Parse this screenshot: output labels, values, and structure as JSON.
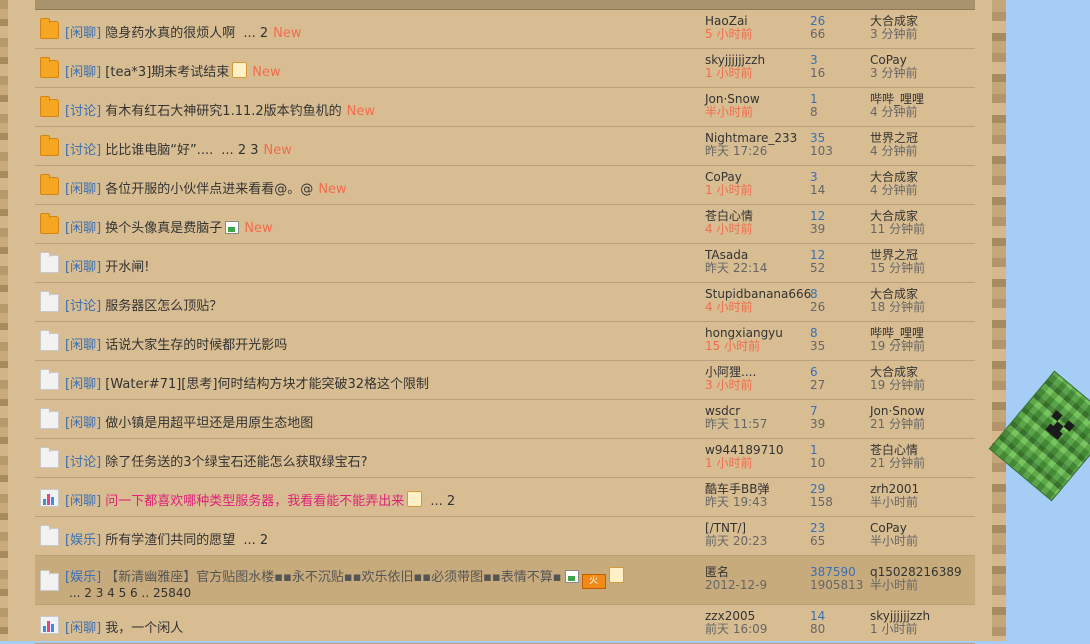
{
  "threads": [
    {
      "icon": "folder-new",
      "type": "[闲聊]",
      "title": "隐身药水真的很烦人啊",
      "title_style": "normal",
      "extras": [],
      "pages": "... 2",
      "is_new": true,
      "author": "HaoZai",
      "author_time": "5 小时前",
      "author_time_recent": true,
      "replies": "26",
      "views": "66",
      "last_user": "大合成家",
      "last_time": "3 分钟前"
    },
    {
      "icon": "folder-new",
      "type": "[闲聊]",
      "title": "[tea*3]期末考试结束",
      "title_style": "normal",
      "extras": [
        "thumb"
      ],
      "pages": "",
      "is_new": true,
      "author": "skyjjjjjjzzh",
      "author_time": "1 小时前",
      "author_time_recent": true,
      "replies": "3",
      "views": "16",
      "last_user": "CoPay",
      "last_time": "3 分钟前"
    },
    {
      "icon": "folder-new",
      "type": "[讨论]",
      "title": "有木有红石大神研究1.11.2版本钓鱼机的",
      "title_style": "normal",
      "extras": [],
      "pages": "",
      "is_new": true,
      "author": "Jon·Snow",
      "author_time": "半小时前",
      "author_time_recent": true,
      "replies": "1",
      "views": "8",
      "last_user": "哔哔_哩哩",
      "last_time": "4 分钟前"
    },
    {
      "icon": "folder-new",
      "type": "[讨论]",
      "title": "比比谁电脑“好”....",
      "title_style": "normal",
      "extras": [],
      "pages": "... 2  3",
      "is_new": true,
      "author": "Nightmare_233",
      "author_time": "昨天 17:26",
      "author_time_recent": false,
      "replies": "35",
      "views": "103",
      "last_user": "世界之冠",
      "last_time": "4 分钟前"
    },
    {
      "icon": "folder-new",
      "type": "[闲聊]",
      "title": "各位开服的小伙伴点进来看看@。@",
      "title_style": "normal",
      "extras": [],
      "pages": "",
      "is_new": true,
      "author": "CoPay",
      "author_time": "1 小时前",
      "author_time_recent": true,
      "replies": "3",
      "views": "14",
      "last_user": "大合成家",
      "last_time": "4 分钟前"
    },
    {
      "icon": "folder-new",
      "type": "[闲聊]",
      "title": "换个头像真是费脑子",
      "title_style": "normal",
      "extras": [
        "image"
      ],
      "pages": "",
      "is_new": true,
      "author": "苍白心情",
      "author_time": "4 小时前",
      "author_time_recent": true,
      "replies": "12",
      "views": "39",
      "last_user": "大合成家",
      "last_time": "11 分钟前"
    },
    {
      "icon": "folder-old",
      "type": "[闲聊]",
      "title": "开水闸!",
      "title_style": "normal",
      "extras": [],
      "pages": "",
      "is_new": false,
      "author": "TAsada",
      "author_time": "昨天 22:14",
      "author_time_recent": false,
      "replies": "12",
      "views": "52",
      "last_user": "世界之冠",
      "last_time": "15 分钟前"
    },
    {
      "icon": "folder-old",
      "type": "[讨论]",
      "title": "服务器区怎么顶贴？",
      "title_style": "normal",
      "extras": [],
      "pages": "",
      "is_new": false,
      "author": "Stupidbanana666",
      "author_time": "4 小时前",
      "author_time_recent": true,
      "replies": "8",
      "views": "26",
      "last_user": "大合成家",
      "last_time": "18 分钟前"
    },
    {
      "icon": "folder-old",
      "type": "[闲聊]",
      "title": "话说大家生存的时候都开光影吗",
      "title_style": "normal",
      "extras": [],
      "pages": "",
      "is_new": false,
      "author": "hongxiangyu",
      "author_time": "15 小时前",
      "author_time_recent": true,
      "replies": "8",
      "views": "35",
      "last_user": "哔哔_哩哩",
      "last_time": "19 分钟前"
    },
    {
      "icon": "folder-old",
      "type": "[闲聊]",
      "title": "[Water#71][思考]何时结构方块才能突破32格这个限制",
      "title_style": "normal",
      "extras": [],
      "pages": "",
      "is_new": false,
      "author": "小阿狸....",
      "author_time": "3 小时前",
      "author_time_recent": true,
      "replies": "6",
      "views": "27",
      "last_user": "大合成家",
      "last_time": "19 分钟前"
    },
    {
      "icon": "folder-old",
      "type": "[闲聊]",
      "title": "做小镇是用超平坦还是用原生态地图",
      "title_style": "normal",
      "extras": [],
      "pages": "",
      "is_new": false,
      "author": "wsdcr",
      "author_time": "昨天 11:57",
      "author_time_recent": false,
      "replies": "7",
      "views": "39",
      "last_user": "Jon·Snow",
      "last_time": "21 分钟前"
    },
    {
      "icon": "folder-old",
      "type": "[讨论]",
      "title": "除了任务送的3个绿宝石还能怎么获取绿宝石?",
      "title_style": "normal",
      "extras": [],
      "pages": "",
      "is_new": false,
      "author": "w944189710",
      "author_time": "1 小时前",
      "author_time_recent": true,
      "replies": "1",
      "views": "10",
      "last_user": "苍白心情",
      "last_time": "21 分钟前"
    },
    {
      "icon": "poll",
      "type": "[闲聊]",
      "title": "问一下都喜欢哪种类型服务器，我看看能不能弄出来",
      "title_style": "hot",
      "extras": [
        "thumb"
      ],
      "pages": "... 2",
      "is_new": false,
      "author": "酷车手BB弹",
      "author_time": "昨天 19:43",
      "author_time_recent": false,
      "replies": "29",
      "views": "158",
      "last_user": "zrh2001",
      "last_time": "半小时前"
    },
    {
      "icon": "folder-old",
      "type": "[娱乐]",
      "title": "所有学渣们共同的愿望",
      "title_style": "normal",
      "extras": [],
      "pages": "... 2",
      "is_new": false,
      "author": "[/TNT/]",
      "author_time": "前天 20:23",
      "author_time_recent": false,
      "replies": "23",
      "views": "65",
      "last_user": "CoPay",
      "last_time": "半小时前"
    },
    {
      "icon": "folder-old",
      "type": "[娱乐]",
      "title": "【新清幽雅座】官方贴图水楼▪▪永不沉贴▪▪欢乐依旧▪▪必须带图▪▪表情不算▪",
      "title_style": "sticky",
      "extras": [
        "image",
        "fire",
        "thumb"
      ],
      "fire_label": "火",
      "pages": "",
      "pages_line2": "... 2  3  4  5  6 .. 25840",
      "is_new": false,
      "sticky": true,
      "author": "匿名",
      "author_time": "2012-12-9",
      "author_time_recent": false,
      "replies": "387590",
      "views": "1905813",
      "last_user": "q15028216389",
      "last_time": "半小时前"
    },
    {
      "icon": "poll",
      "type": "[闲聊]",
      "title": "我，一个闲人",
      "title_style": "normal",
      "extras": [],
      "pages": "",
      "is_new": false,
      "author": "zzx2005",
      "author_time": "前天 16:09",
      "author_time_recent": false,
      "replies": "14",
      "views": "80",
      "last_user": "skyjjjjjjzzh",
      "last_time": "1 小时前"
    }
  ],
  "labels": {
    "new": "New"
  },
  "colors": {
    "parchment": "#d8bd92",
    "type_link": "#3a6fb5",
    "new_badge": "#f26c4f",
    "hot_title": "#e0207a",
    "sky": "#a6cdf6"
  }
}
